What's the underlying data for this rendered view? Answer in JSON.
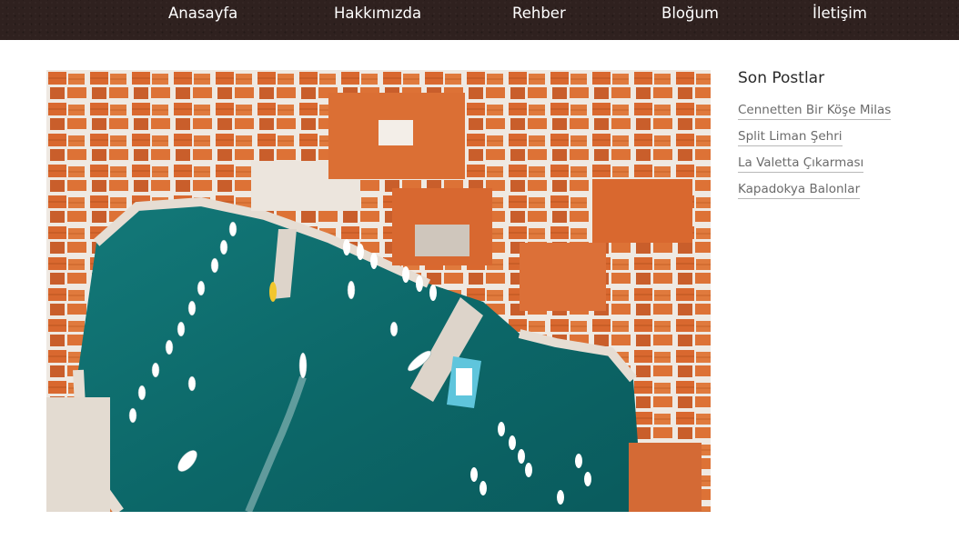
{
  "nav": {
    "items": [
      {
        "label": "Anasayfa"
      },
      {
        "label": "Hakkımızda"
      },
      {
        "label": "Rehber"
      },
      {
        "label": "Bloğum"
      },
      {
        "label": "İletişim"
      }
    ]
  },
  "sidebar": {
    "title": "Son Postlar",
    "posts": [
      {
        "label": "Cennetten Bir Köşe Milas"
      },
      {
        "label": "Split Liman Şehri"
      },
      {
        "label": "La Valetta Çıkarması"
      },
      {
        "label": "Kapadokya Balonlar"
      }
    ]
  },
  "colors": {
    "nav_bg": "#2f211f",
    "sea": "#0f6f70",
    "roof": "#d9682f",
    "stone": "#e9e3dc"
  }
}
